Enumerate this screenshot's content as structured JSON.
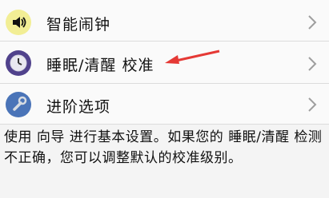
{
  "menu": {
    "items": [
      {
        "label": "智能闹钟",
        "icon": "speaker-icon"
      },
      {
        "label": "睡眠/清醒 校准",
        "icon": "clock-icon"
      },
      {
        "label": "进阶选项",
        "icon": "wrench-icon"
      }
    ]
  },
  "description": {
    "text": "使用 向导 进行基本设置。如果您的 睡眠/清醒 检测不正确，您可以调整默认的校准级别。"
  },
  "colors": {
    "speaker_icon_bg": "#f2ee95",
    "clock_icon_bg": "#50428c",
    "wrench_icon_bg": "#4a74b8",
    "annotation_arrow": "#e53935",
    "chevron": "#9e9e9e"
  }
}
